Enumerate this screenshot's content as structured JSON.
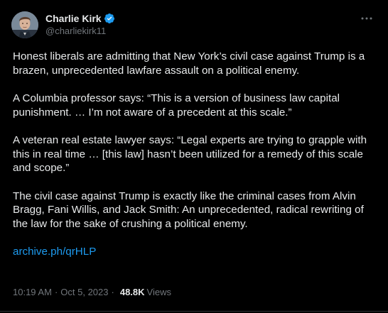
{
  "author": {
    "display_name": "Charlie Kirk",
    "handle": "@charliekirk11",
    "verified": true
  },
  "menu_icon": "more-horizontal-icon",
  "body": {
    "paragraphs": [
      "Honest liberals are admitting that New York’s civil case against Trump is a brazen, unprecedented lawfare assault on a political enemy.",
      "A Columbia professor says: “This is a version of business law capital punishment. … I’m not aware of a precedent at this scale.”",
      "A veteran real estate lawyer says: “Legal experts are trying to grapple with this in real time … [this law] hasn’t been utilized for a remedy of this scale and scope.”",
      "The civil case against Trump is exactly like the criminal cases from Alvin Bragg, Fani Willis, and Jack Smith: An unprecedented, radical rewriting of the law for the sake of crushing a political enemy."
    ],
    "link_text": "archive.ph/qrHLP"
  },
  "meta": {
    "time": "10:19 AM",
    "separator": "·",
    "date": "Oct 5, 2023",
    "separator2": "·",
    "views_count": "48.8K",
    "views_label": "Views"
  },
  "colors": {
    "background": "#000000",
    "text": "#e7e9ea",
    "muted": "#71767b",
    "link": "#1d9bf0",
    "verified": "#1d9bf0"
  }
}
